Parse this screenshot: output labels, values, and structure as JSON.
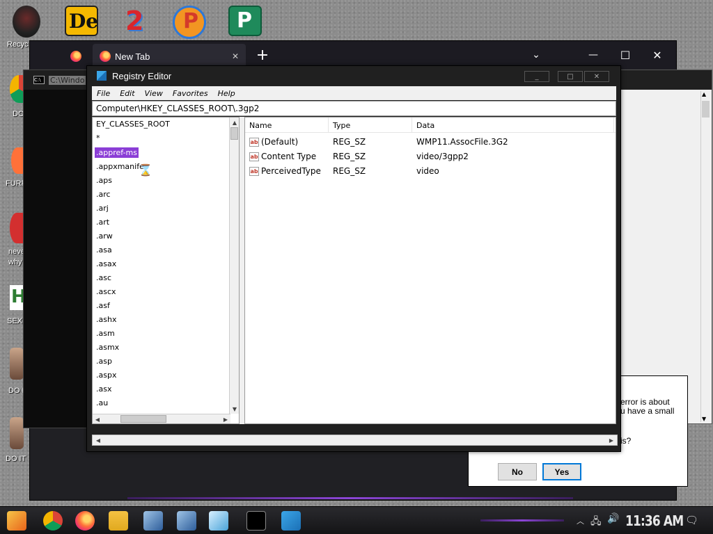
{
  "desktop": {
    "icons": [
      {
        "label": "Recyc"
      },
      {
        "label": "DO"
      },
      {
        "label": "FURF"
      },
      {
        "label": "neve"
      },
      {
        "label": "why"
      },
      {
        "label": "SEX"
      },
      {
        "label": "DO I"
      },
      {
        "label": "DO IT"
      }
    ]
  },
  "browser": {
    "tab_label": "New Tab",
    "new_tab_glyph": "+",
    "controls": {
      "minimize": "—",
      "maximize": "☐",
      "close": "✕"
    }
  },
  "cmd": {
    "title": "C:\\Windo"
  },
  "dialog": {
    "text_lines": [
      "error is about",
      "u have a small",
      "is?"
    ],
    "no_label": "No",
    "yes_label": "Yes"
  },
  "regedit": {
    "title": "Registry Editor",
    "menu": [
      "File",
      "Edit",
      "View",
      "Favorites",
      "Help"
    ],
    "address": "Computer\\HKEY_CLASSES_ROOT\\.3gp2",
    "tree_items": [
      "EY_CLASSES_ROOT",
      "*",
      ".appref-ms",
      ".appxmanife",
      ".aps",
      ".arc",
      ".arj",
      ".art",
      ".arw",
      ".asa",
      ".asax",
      ".asc",
      ".ascx",
      ".asf",
      ".ashx",
      ".asm",
      ".asmx",
      ".asp",
      ".aspx",
      ".asx",
      ".au"
    ],
    "selected_tree_item": ".appref-ms",
    "columns": [
      "Name",
      "Type",
      "Data"
    ],
    "values": [
      {
        "name": "(Default)",
        "type": "REG_SZ",
        "data": "WMP11.AssocFile.3G2"
      },
      {
        "name": "Content Type",
        "type": "REG_SZ",
        "data": "video/3gpp2"
      },
      {
        "name": "PerceivedType",
        "type": "REG_SZ",
        "data": "video"
      }
    ]
  },
  "taskbar": {
    "clock": "11:36 AM"
  }
}
